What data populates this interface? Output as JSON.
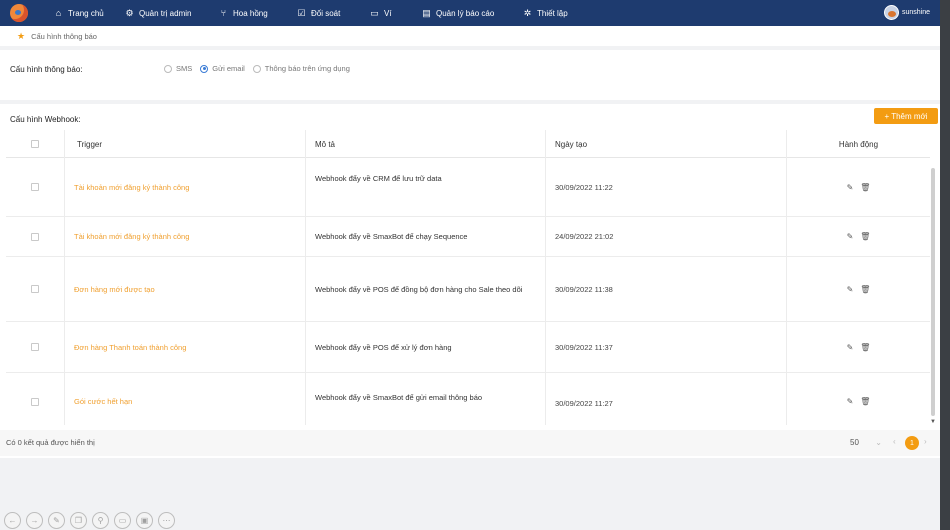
{
  "nav": {
    "items": [
      {
        "label": "Trang chủ",
        "icon": "home-icon"
      },
      {
        "label": "Quản trị admin",
        "icon": "admin-icon"
      },
      {
        "label": "Hoa hồng",
        "icon": "commission-icon"
      },
      {
        "label": "Đối soát",
        "icon": "reconcile-icon"
      },
      {
        "label": "Ví",
        "icon": "wallet-icon"
      },
      {
        "label": "Quản lý báo cáo",
        "icon": "report-icon"
      },
      {
        "label": "Thiết lập",
        "icon": "gear-icon"
      }
    ],
    "user_name": "sunshine"
  },
  "breadcrumb": {
    "label": "Cấu hình thông báo"
  },
  "notification": {
    "label": "Cấu hình thông báo:",
    "options": [
      {
        "label": "SMS",
        "selected": false
      },
      {
        "label": "Gửi email",
        "selected": true
      },
      {
        "label": "Thông báo trên ứng dụng",
        "selected": false
      }
    ]
  },
  "webhook": {
    "label": "Cấu hình Webhook:",
    "add_button": "+ Thêm mới",
    "columns": [
      "Trigger",
      "Mô tả",
      "Ngày tạo",
      "Hành động"
    ],
    "rows": [
      {
        "trigger": "Tài khoản mới đăng ký thành công",
        "description": "Webhook đẩy về CRM để lưu trữ data",
        "created": "30/09/2022 11:22"
      },
      {
        "trigger": "Tài khoản mới đăng ký thành công",
        "description": "Webhook đẩy về SmaxBot để chạy Sequence",
        "created": "24/09/2022 21:02"
      },
      {
        "trigger": "Đơn hàng mới được tạo",
        "description": "Webhook đẩy về POS để đồng bộ đơn hàng cho Sale theo dõi",
        "created": "30/09/2022 11:38"
      },
      {
        "trigger": "Đơn hàng Thanh toán thành công",
        "description": "Webhook đẩy về POS để xử lý đơn hàng",
        "created": "30/09/2022 11:37"
      },
      {
        "trigger": "Gói cước hết hạn",
        "description": "Webhook đẩy về SmaxBot để gửi email thông báo",
        "created": "30/09/2022 11:27"
      }
    ]
  },
  "footer": {
    "result_text": "Có 0 kết quả được hiển thị",
    "page_size": "50",
    "current_page": "1"
  },
  "colors": {
    "nav_bg": "#1e3b6f",
    "accent": "#f39c12",
    "trigger_text": "#f0a030"
  }
}
